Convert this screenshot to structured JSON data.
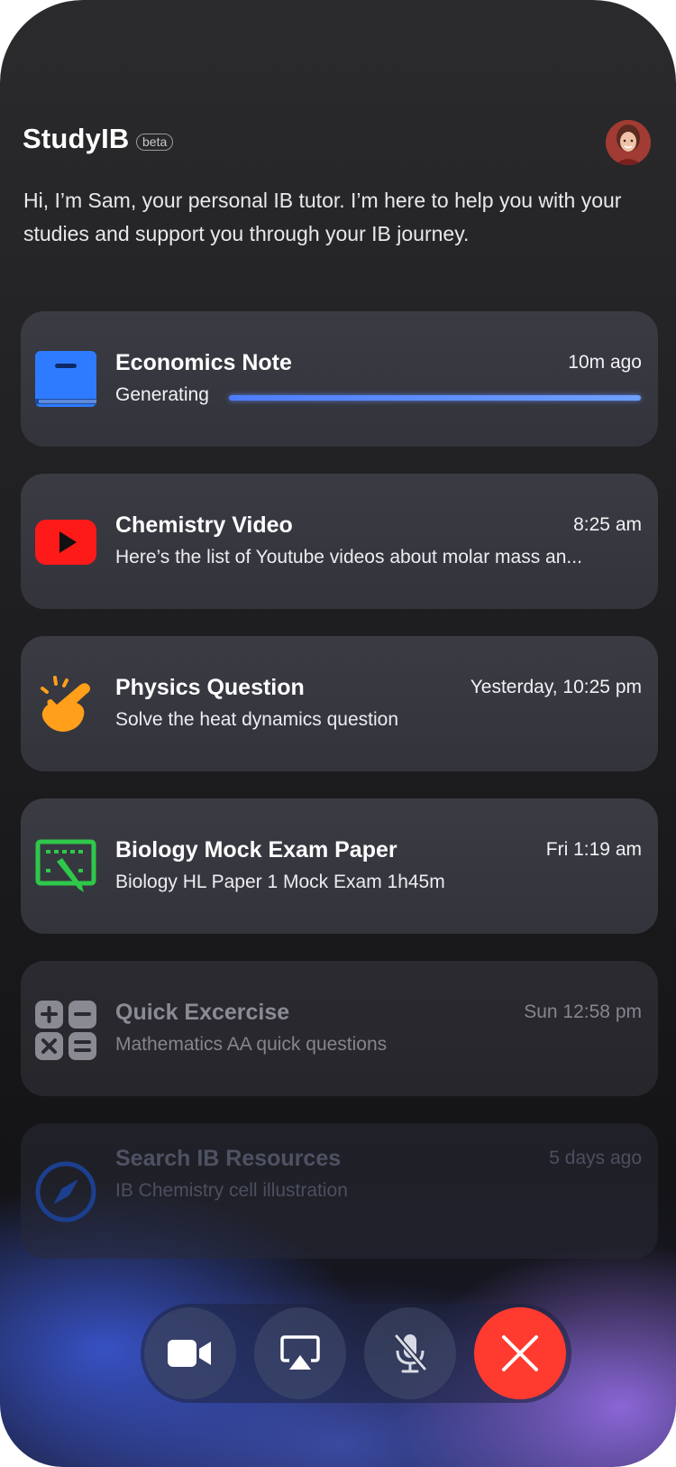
{
  "app": {
    "title": "StudyIB",
    "badge": "beta"
  },
  "intro": "Hi, I’m Sam, your personal IB tutor. I’m here to help you with your studies and support you through your IB journey.",
  "tasks": [
    {
      "title": "Economics Note",
      "time": "10m ago",
      "subtitle": "Generating",
      "icon": "book-icon",
      "progress": 1.0,
      "color": "#2f7bff"
    },
    {
      "title": "Chemistry Video",
      "time": "8:25 am",
      "subtitle": "Here’s the list of Youtube videos about molar mass an...",
      "icon": "youtube-icon",
      "color": "#ff1a1a"
    },
    {
      "title": "Physics Question",
      "time": "Yesterday, 10:25 pm",
      "subtitle": "Solve the heat dynamics question",
      "icon": "tap-hand-icon",
      "color": "#ff9f1a"
    },
    {
      "title": "Biology Mock Exam Paper",
      "time": "Fri 1:19 am",
      "subtitle": "Biology HL Paper 1 Mock Exam 1h45m",
      "icon": "exam-board-icon",
      "color": "#2ec84a"
    },
    {
      "title": "Quick Excercise",
      "time": "Sun 12:58 pm",
      "subtitle": "Mathematics AA quick questions",
      "icon": "calculator-icon",
      "color": "#8a8a92"
    },
    {
      "title": "Search IB Resources",
      "time": "5 days ago",
      "subtitle": "IB Chemistry cell illustration",
      "icon": "compass-icon",
      "color": "#1c3f8f"
    }
  ],
  "controls": [
    "video-camera-icon",
    "airplay-icon",
    "mic-muted-icon",
    "close-icon"
  ]
}
